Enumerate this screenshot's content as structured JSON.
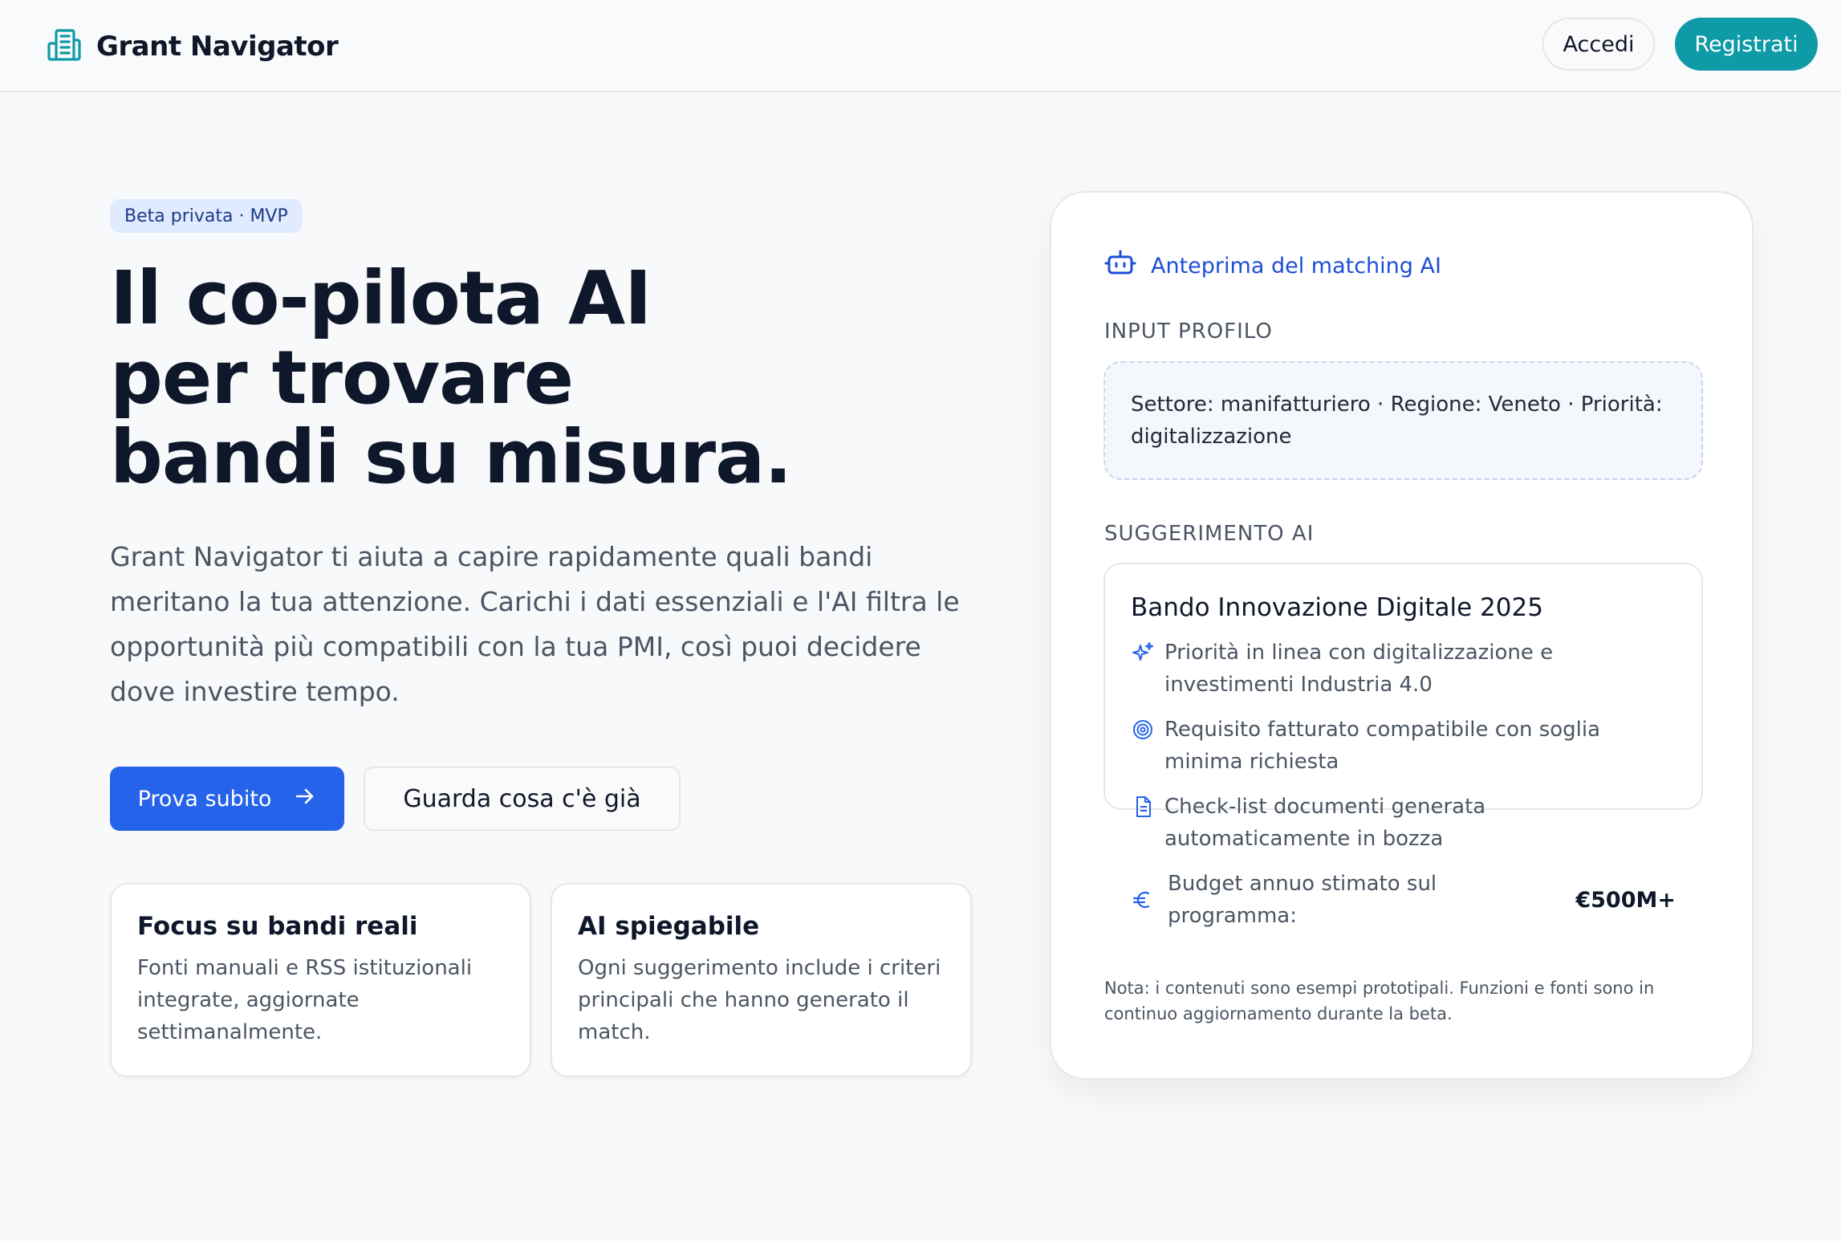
{
  "header": {
    "brand_name": "Grant Navigator",
    "login_label": "Accedi",
    "signup_label": "Registrati"
  },
  "hero": {
    "badge": "Beta privata · MVP",
    "title_lines": [
      "Il co-pilota AI",
      "per trovare",
      "bandi su misura."
    ],
    "description": "Grant Navigator ti aiuta a capire rapidamente quali bandi meritano la tua attenzione. Carichi i dati essenziali e l'AI filtra le opportunità più compatibili con la tua PMI, così puoi decidere dove investire tempo.",
    "primary_cta": "Prova subito",
    "secondary_cta": "Guarda cosa c'è già"
  },
  "features": [
    {
      "title": "Focus su bandi reali",
      "text": "Fonti manuali e RSS istituzionali integrate, aggiornate settimanalmente."
    },
    {
      "title": "AI spiegabile",
      "text": "Ogni suggerimento include i criteri principali che hanno generato il match."
    }
  ],
  "preview": {
    "heading": "Anteprima del matching AI",
    "input_label": "INPUT PROFILO",
    "profile_text": "Settore: manifatturiero · Regione: Veneto · Priorità: digitalizzazione",
    "suggestion_label": "SUGGERIMENTO AI",
    "grant_title": "Bando Innovazione Digitale 2025",
    "reasons": [
      {
        "icon": "sparkles-icon",
        "text": "Priorità in linea con digitalizzazione e investimenti Industria 4.0"
      },
      {
        "icon": "target-icon",
        "text": "Requisito fatturato compatibile con soglia minima richiesta"
      },
      {
        "icon": "document-icon",
        "text": "Check-list documenti generata automaticamente in bozza"
      }
    ],
    "budget_label": "Budget annuo stimato sul programma:",
    "budget_value": "€500M+",
    "note": "Nota: i contenuti sono esempi prototipali. Funzioni e fonti sono in continuo aggiornamento durante la beta."
  },
  "colors": {
    "brand_teal": "#0e9aa7",
    "primary_blue": "#2563eb",
    "accent_blue": "#1d4ed8",
    "badge_bg": "#e0ebff",
    "text_dark": "#0f172a",
    "text_muted": "#4b5563"
  }
}
